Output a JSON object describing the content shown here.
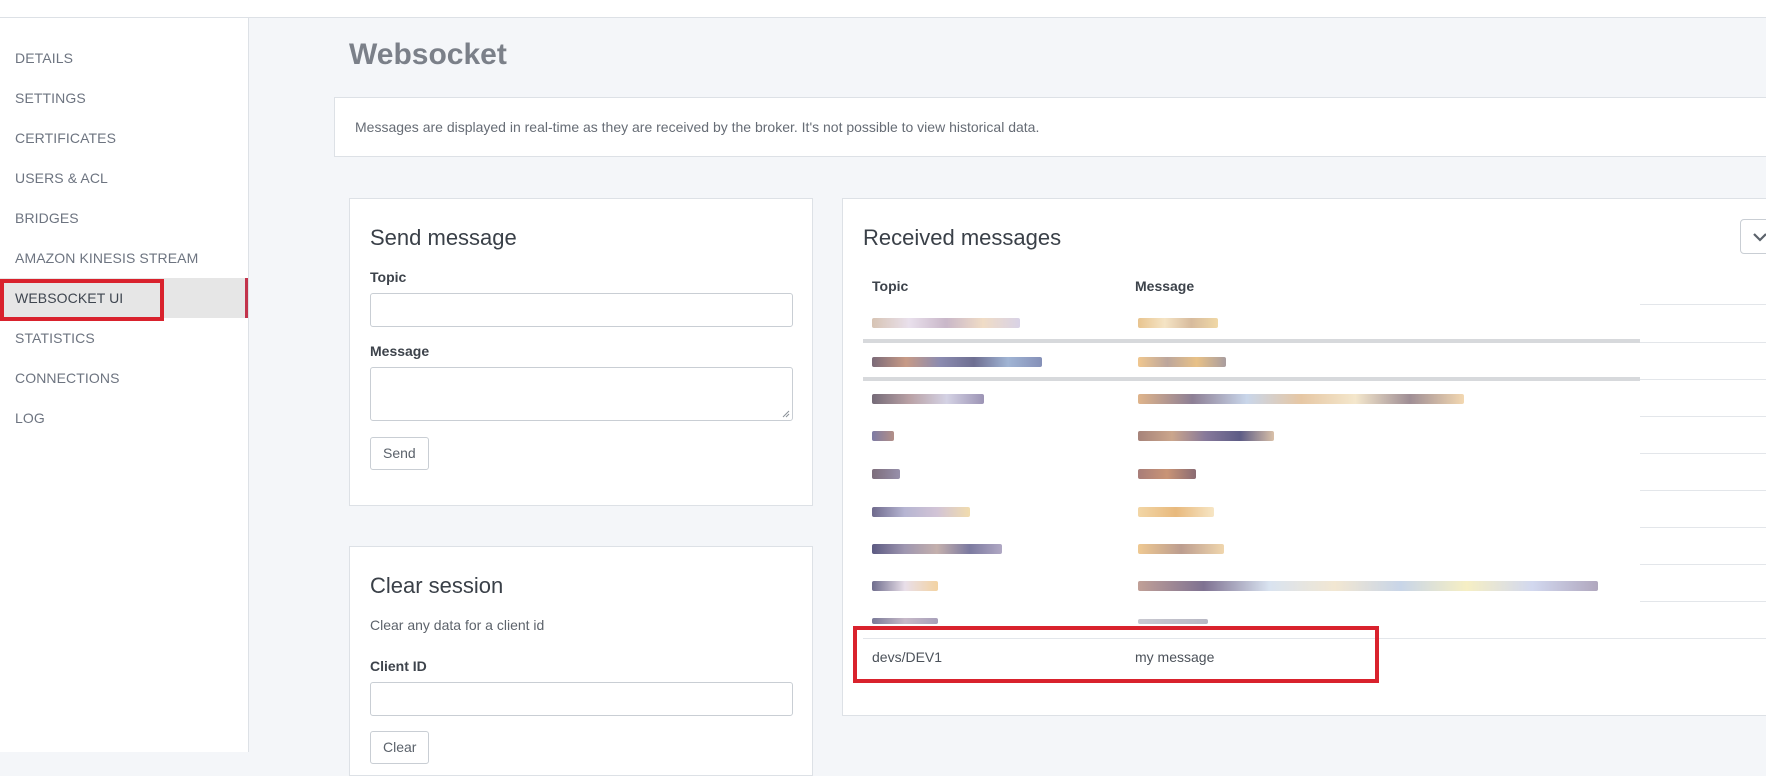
{
  "sidebar": {
    "items": [
      {
        "label": "DETAILS"
      },
      {
        "label": "SETTINGS"
      },
      {
        "label": "CERTIFICATES"
      },
      {
        "label": "USERS & ACL"
      },
      {
        "label": "BRIDGES"
      },
      {
        "label": "AMAZON KINESIS STREAM"
      },
      {
        "label": "WEBSOCKET UI"
      },
      {
        "label": "STATISTICS"
      },
      {
        "label": "CONNECTIONS"
      },
      {
        "label": "LOG"
      }
    ],
    "active_index": 6
  },
  "page": {
    "title": "Websocket",
    "info": "Messages are displayed in real-time as they are received by the broker. It's not possible to view historical data."
  },
  "send_message": {
    "title": "Send message",
    "topic_label": "Topic",
    "topic_value": "",
    "message_label": "Message",
    "message_value": "",
    "send_button": "Send"
  },
  "clear_session": {
    "title": "Clear session",
    "description": "Clear any data for a client id",
    "client_id_label": "Client ID",
    "client_id_value": "",
    "clear_button": "Clear"
  },
  "received_messages": {
    "title": "Received messages",
    "columns": [
      "Topic",
      "Message"
    ],
    "dropdown_icon": "chevron-down-icon",
    "visible_row": {
      "topic": "devs/DEV1",
      "message": "my message"
    }
  },
  "colors": {
    "accent_red": "#d9222d",
    "active_marker": "#c2334b",
    "sidebar_active_bg": "#e6e6e6"
  }
}
